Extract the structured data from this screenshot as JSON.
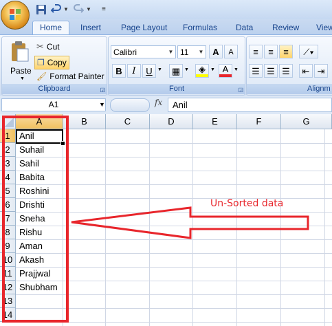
{
  "ribbon_tabs": [
    "Home",
    "Insert",
    "Page Layout",
    "Formulas",
    "Data",
    "Review",
    "View"
  ],
  "clipboard": {
    "paste_label": "Paste",
    "cut_label": "Cut",
    "copy_label": "Copy",
    "format_painter_label": "Format Painter",
    "group_label": "Clipboard"
  },
  "font": {
    "font_name": "Calibri",
    "font_size": "11",
    "group_label": "Font",
    "bold_label": "B",
    "italic_label": "I",
    "underline_label": "U",
    "grow_label": "A",
    "shrink_label": "A",
    "color_label": "A"
  },
  "alignment": {
    "group_label": "Alignm"
  },
  "formula_bar": {
    "name_box": "A1",
    "fx_label": "fx",
    "value": "Anil"
  },
  "columns": [
    "A",
    "B",
    "C",
    "D",
    "E",
    "F",
    "G"
  ],
  "rows": [
    "1",
    "2",
    "3",
    "4",
    "5",
    "6",
    "7",
    "8",
    "9",
    "10",
    "11",
    "12",
    "13",
    "14"
  ],
  "cells_a": [
    "Anil",
    "Suhail",
    "Sahil",
    "Babita",
    "Roshini",
    "Drishti",
    "Sneha",
    "Rishu",
    "Aman",
    "Akash",
    "Prajjwal",
    "Shubham",
    "",
    ""
  ],
  "annotation": {
    "text": "Un-Sorted data"
  },
  "colors": {
    "highlight": "#e8262c",
    "ribbon_text": "#15428b",
    "selected_header": "#f1c15f"
  }
}
